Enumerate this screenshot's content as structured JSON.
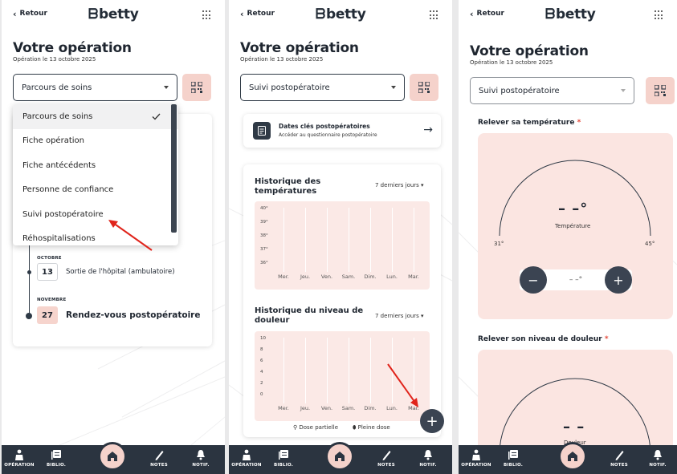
{
  "common": {
    "back_label": "Retour",
    "logo_text": "betty",
    "page_title": "Votre opération",
    "page_subtitle": "Opération le 13 octobre 2025"
  },
  "screen1": {
    "select_value": "Parcours de soins",
    "dropdown_items": [
      {
        "label": "Parcours de soins",
        "selected": true
      },
      {
        "label": "Fiche opération",
        "selected": false
      },
      {
        "label": "Fiche antécédents",
        "selected": false
      },
      {
        "label": "Personne de confiance",
        "selected": false
      },
      {
        "label": "Suivi postopératoire",
        "selected": false
      },
      {
        "label": "Réhospitalisations",
        "selected": false
      }
    ],
    "timeline": [
      {
        "month": "OCTOBRE",
        "day": "13",
        "text": "Sortie de l'hôpital (ambulatoire)"
      },
      {
        "month": "NOVEMBRE",
        "day": "27",
        "text": "Rendez-vous postopératoire"
      }
    ]
  },
  "screen2": {
    "select_value": "Suivi postopératoire",
    "key_dates": {
      "title": "Dates clés postopératoires",
      "subtitle": "Accéder au questionnaire postopératoire"
    },
    "temp_history": {
      "title": "Historique des températures",
      "range": "7 derniers jours",
      "y_ticks": [
        "40°",
        "39°",
        "38°",
        "37°",
        "36°"
      ],
      "x_ticks": [
        "Mer.",
        "Jeu.",
        "Ven.",
        "Sam.",
        "Dim.",
        "Lun.",
        "Mar."
      ]
    },
    "pain_history": {
      "title": "Historique du niveau de douleur",
      "range": "7 derniers jours",
      "y_ticks": [
        "10",
        "8",
        "6",
        "4",
        "2",
        "0"
      ],
      "x_ticks": [
        "Mer.",
        "Jeu.",
        "Ven.",
        "Sam.",
        "Dim.",
        "Lun.",
        "Mar."
      ]
    },
    "legend": {
      "partial": "Dose partielle",
      "full": "Pleine dose"
    },
    "fab_label": "+"
  },
  "screen3": {
    "select_value": "Suivi postopératoire",
    "temp_section": {
      "label": "Relever sa température",
      "required_mark": "*",
      "value": "– –°",
      "gauge_label": "Température",
      "min": "31°",
      "max": "45°",
      "stepper_value": "– –°",
      "minus": "−",
      "plus": "+"
    },
    "pain_section": {
      "label": "Relever son niveau de douleur",
      "required_mark": "*",
      "value": "– –",
      "gauge_label": "Douleur"
    }
  },
  "nav": {
    "items": [
      "OPÉRATION",
      "BIBLIO.",
      "NOTES",
      "NOTIF."
    ]
  },
  "colors": {
    "dark": "#2b3440",
    "pink": "#f5d2cb",
    "pink_light": "#fbe5e1",
    "annotation_red": "#e0241b"
  }
}
